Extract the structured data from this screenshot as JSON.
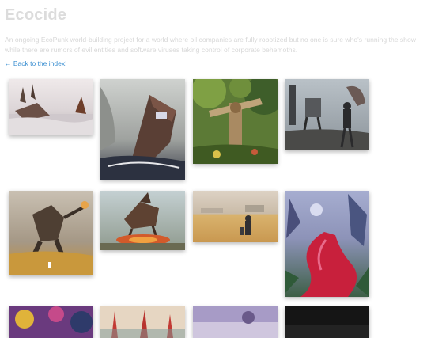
{
  "page": {
    "title": "Ecocide",
    "description": "An ongoing EcoPunk world-building project for a world where oil companies are fully robotized but no one is sure who's running the show while there are rumors of evil entities and software viruses taking control of corporate behemoths.",
    "back_link": "← Back to the index!"
  },
  "gallery": {
    "artworks": [
      {
        "subject": "shipwreck in water",
        "palette": [
          "#e9e4e4",
          "#c9c4c6",
          "#6b4a3a"
        ]
      },
      {
        "subject": "sinking oil tanker in storm",
        "palette": [
          "#a8aba8",
          "#4a4644",
          "#2a2e3a"
        ]
      },
      {
        "subject": "overgrown oil pump in forest",
        "palette": [
          "#4f6e2c",
          "#c0a37a",
          "#7a6030"
        ]
      },
      {
        "subject": "robot walker in wasteland",
        "palette": [
          "#a7b1b9",
          "#55585a",
          "#2c2c2c"
        ]
      },
      {
        "subject": "giant robot over wheat field",
        "palette": [
          "#bdb3a5",
          "#6d5a44",
          "#c9932f"
        ]
      },
      {
        "subject": "mech creature in fire",
        "palette": [
          "#b9c6c9",
          "#6a4a36",
          "#d0542a"
        ]
      },
      {
        "subject": "figures in golden field",
        "palette": [
          "#d6c8b8",
          "#d7b070",
          "#3a3a3a"
        ]
      },
      {
        "subject": "red river in alien landscape",
        "palette": [
          "#9fa6c6",
          "#c8203c",
          "#3f6e4a"
        ]
      },
      {
        "subject": "colorful coral forest",
        "palette": [
          "#7a3a8a",
          "#e0b33a",
          "#2e3a6a"
        ]
      },
      {
        "subject": "red plants on shore",
        "palette": [
          "#e8d6c0",
          "#c23a34",
          "#6a8a8a"
        ]
      },
      {
        "subject": "purple dusk scene",
        "palette": [
          "#a89bc6",
          "#6a5a8a",
          "#cfc6de"
        ]
      },
      {
        "subject": "dark night scene",
        "palette": [
          "#141414",
          "#2a2a2a",
          "#3a3a3a"
        ]
      }
    ]
  }
}
